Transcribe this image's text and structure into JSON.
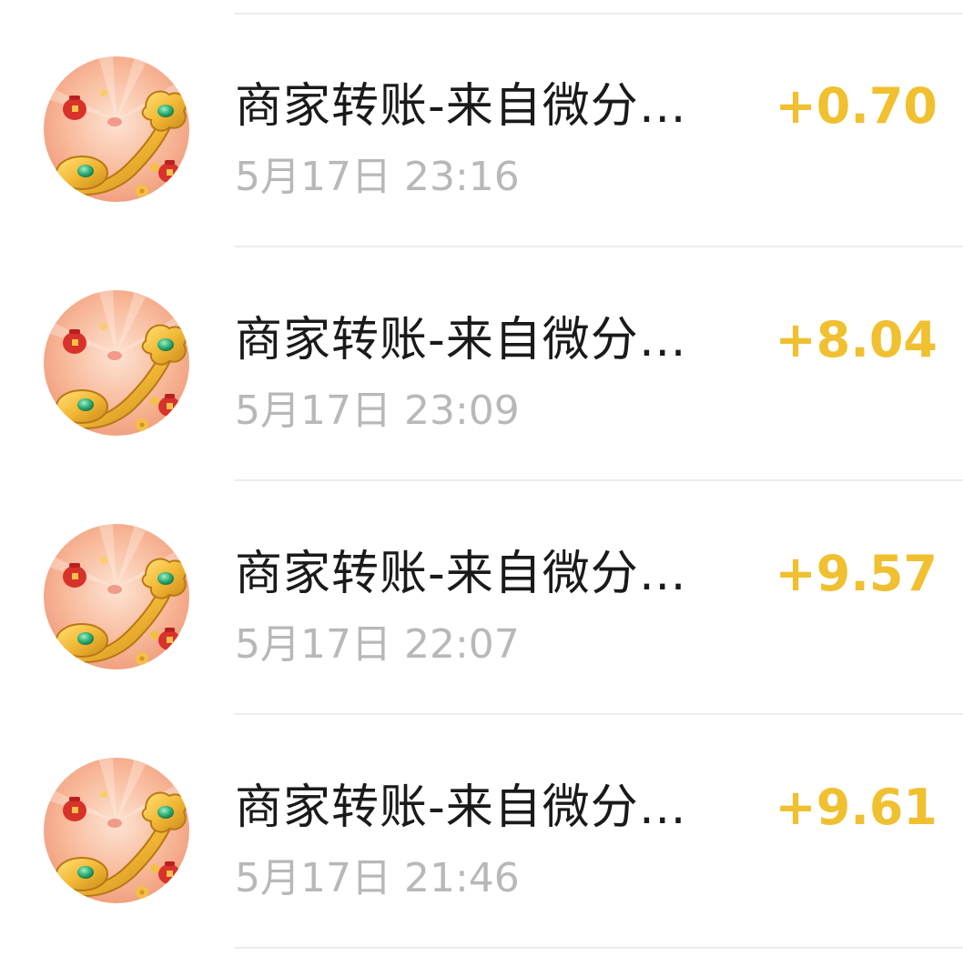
{
  "transactions": [
    {
      "title": "商家转账-来自微分…",
      "time": "5月17日 23:16",
      "amount": "+0.70",
      "icon": "ruyi-scepter-icon"
    },
    {
      "title": "商家转账-来自微分…",
      "time": "5月17日 23:09",
      "amount": "+8.04",
      "icon": "ruyi-scepter-icon"
    },
    {
      "title": "商家转账-来自微分…",
      "time": "5月17日 22:07",
      "amount": "+9.57",
      "icon": "ruyi-scepter-icon"
    },
    {
      "title": "商家转账-来自微分…",
      "time": "5月17日 21:46",
      "amount": "+9.61",
      "icon": "ruyi-scepter-icon"
    }
  ],
  "colors": {
    "amount": "#f0c030",
    "title": "#1a1a1a",
    "time": "#b8b8b8",
    "divider": "#ededed",
    "avatar_bg": "#f6b89a"
  }
}
